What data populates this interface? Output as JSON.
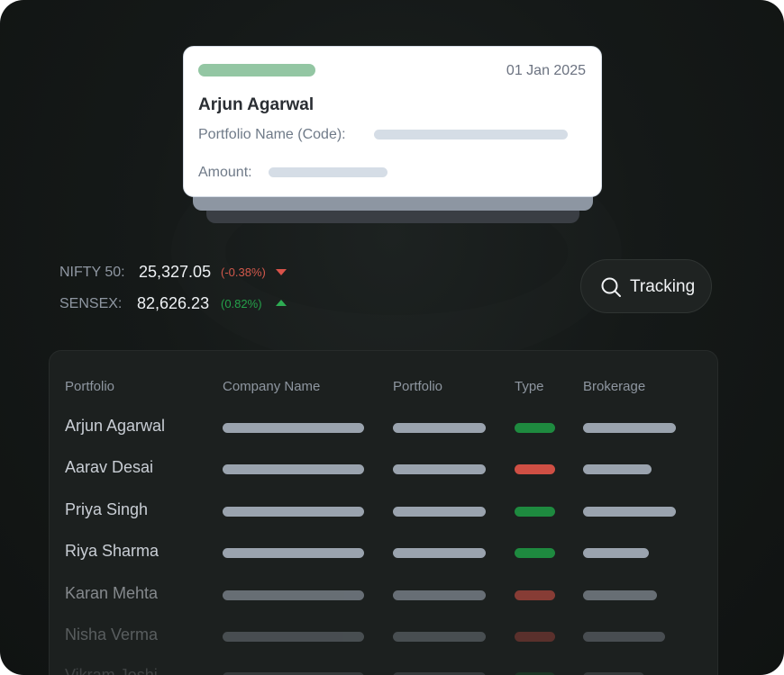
{
  "card": {
    "date": "01 Jan 2025",
    "name": "Arjun Agarwal",
    "portfolio_label": "Portfolio Name (Code):",
    "amount_label": "Amount:"
  },
  "indices": [
    {
      "name": "NIFTY 50:",
      "value": "25,327.05",
      "change": "(-0.38%)",
      "direction": "down",
      "color": "#d9534a"
    },
    {
      "name": "SENSEX:",
      "value": "82,626.23",
      "change": "(0.82%)",
      "direction": "up",
      "color": "#2eac53"
    }
  ],
  "tracking_button": {
    "label": "Tracking",
    "icon": "search-icon"
  },
  "table": {
    "headers": [
      "Portfolio",
      "Company Name",
      "Portfolio",
      "Type",
      "Brokerage"
    ],
    "rows": [
      {
        "name": "Arjun Agarwal",
        "type": "buy"
      },
      {
        "name": "Aarav Desai",
        "type": "sell"
      },
      {
        "name": "Priya Singh",
        "type": "buy"
      },
      {
        "name": "Riya Sharma",
        "type": "buy"
      },
      {
        "name": "Karan Mehta",
        "type": "sell"
      },
      {
        "name": "Nisha Verma",
        "type": "sell"
      },
      {
        "name": "Vikram Joshi",
        "type": "buy"
      }
    ]
  },
  "colors": {
    "buy": "#1e8a3f",
    "sell": "#cf4f44",
    "accent": "#93c6a3"
  }
}
